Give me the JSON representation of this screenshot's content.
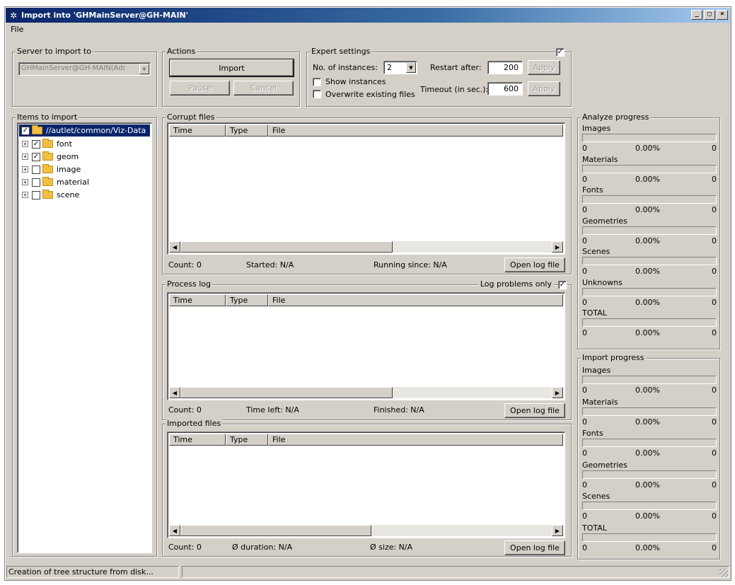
{
  "window": {
    "title": "Import into 'GHMainServer@GH-MAIN'",
    "controls": [
      "_",
      "□",
      "×"
    ]
  },
  "menu": {
    "file": "File"
  },
  "server": {
    "group_label": "Server to import to",
    "value": "GHMainServer@GH-MAIN(Adr"
  },
  "actions": {
    "group_label": "Actions",
    "import": "Import",
    "pause": "Pause",
    "cancel": "Cancel"
  },
  "expert": {
    "group_label": "Expert settings",
    "enabled": true,
    "instances_label": "No. of instances:",
    "instances_value": "2",
    "restart_label": "Restart after:",
    "restart_value": "200",
    "apply": "Apply",
    "show_instances": "Show instances",
    "overwrite": "Overwrite existing files",
    "timeout_label": "Timeout (in sec.):",
    "timeout_value": "600"
  },
  "items": {
    "group_label": "Items to import",
    "root": "//autlet/common/Viz-Data",
    "children": [
      {
        "label": "font",
        "checked": true
      },
      {
        "label": "geom",
        "checked": true
      },
      {
        "label": "image",
        "checked": false
      },
      {
        "label": "material",
        "checked": false
      },
      {
        "label": "scene",
        "checked": false
      }
    ]
  },
  "columns": {
    "time": "Time",
    "type": "Type",
    "file": "File"
  },
  "corrupt": {
    "group_label": "Corrupt files",
    "count": "Count: 0",
    "started": "Started: N/A",
    "running": "Running since: N/A",
    "open_log": "Open log file"
  },
  "process": {
    "group_label": "Process log",
    "log_problems": "Log problems only",
    "log_problems_checked": true,
    "count": "Count: 0",
    "time_left": "Time left: N/A",
    "finished": "Finished: N/A",
    "open_log": "Open log file"
  },
  "imported": {
    "group_label": "Imported files",
    "count": "Count: 0",
    "duration": "Ø duration: N/A",
    "size": "Ø size: N/A",
    "open_log": "Open log file"
  },
  "analyze": {
    "group_label": "Analyze progress",
    "rows": [
      {
        "name": "Images",
        "count": "0",
        "percent": "0.00%",
        "total": "0"
      },
      {
        "name": "Materials",
        "count": "0",
        "percent": "0.00%",
        "total": "0"
      },
      {
        "name": "Fonts",
        "count": "0",
        "percent": "0.00%",
        "total": "0"
      },
      {
        "name": "Geometries",
        "count": "0",
        "percent": "0.00%",
        "total": "0"
      },
      {
        "name": "Scenes",
        "count": "0",
        "percent": "0.00%",
        "total": "0"
      },
      {
        "name": "Unknowns",
        "count": "0",
        "percent": "0.00%",
        "total": "0"
      },
      {
        "name": "TOTAL",
        "count": "0",
        "percent": "0.00%",
        "total": "0"
      }
    ]
  },
  "import_progress": {
    "group_label": "Import progress",
    "rows": [
      {
        "name": "Images",
        "count": "0",
        "percent": "0.00%",
        "total": "0"
      },
      {
        "name": "Materials",
        "count": "0",
        "percent": "0.00%",
        "total": "0"
      },
      {
        "name": "Fonts",
        "count": "0",
        "percent": "0.00%",
        "total": "0"
      },
      {
        "name": "Geometries",
        "count": "0",
        "percent": "0.00%",
        "total": "0"
      },
      {
        "name": "Scenes",
        "count": "0",
        "percent": "0.00%",
        "total": "0"
      },
      {
        "name": "TOTAL",
        "count": "0",
        "percent": "0.00%",
        "total": "0"
      }
    ]
  },
  "status": {
    "message": "Creation of tree structure from disk..."
  }
}
